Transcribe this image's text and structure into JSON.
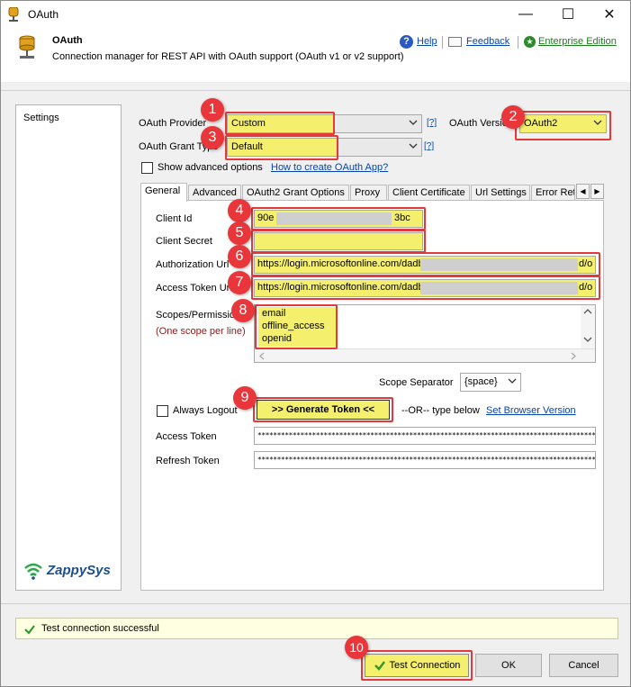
{
  "window": {
    "title": "OAuth",
    "minimize": "—",
    "maximize": "☐",
    "close": "✕"
  },
  "header": {
    "title": "OAuth",
    "subtitle": "Connection manager for REST API with OAuth support (OAuth v1 or v2 support)",
    "help": "Help",
    "feedback": "Feedback",
    "enterprise": "Enterprise Edition"
  },
  "sidebar": {
    "items": [
      {
        "label": "Settings"
      }
    ],
    "logo": "ZappySys"
  },
  "form": {
    "provider_label": "OAuth Provider",
    "provider_value": "Custom",
    "provider_help": "[?]",
    "version_label": "OAuth Version",
    "version_value": "OAuth2",
    "grant_label": "OAuth Grant Type",
    "grant_value": "Default",
    "grant_help": "[?]",
    "advanced_label": "Show advanced options",
    "howto_link": "How to create OAuth App?"
  },
  "tabs": [
    {
      "label": "General"
    },
    {
      "label": "Advanced"
    },
    {
      "label": "OAuth2 Grant Options"
    },
    {
      "label": "Proxy"
    },
    {
      "label": "Client Certificate"
    },
    {
      "label": "Url Settings"
    },
    {
      "label": "Error Ret"
    }
  ],
  "general": {
    "client_id_label": "Client Id",
    "client_id_prefix": "90e",
    "client_id_suffix": "3bc",
    "client_secret_label": "Client Secret",
    "auth_url_label": "Authorization Url",
    "auth_url_prefix": "https://login.microsoftonline.com/dadb",
    "auth_url_suffix": "d/o",
    "token_url_label": "Access Token Url",
    "token_url_prefix": "https://login.microsoftonline.com/dadb",
    "token_url_suffix": "d/o",
    "scopes_label": "Scopes/Permissions",
    "scopes_hint": "(One scope per line)",
    "scopes": [
      "email",
      "offline_access",
      "openid"
    ],
    "separator_label": "Scope Separator",
    "separator_value": "{space}",
    "always_logout_label": "Always Logout",
    "generate_button": ">> Generate Token <<",
    "or_text": "--OR-- type below",
    "browser_link": "Set Browser Version",
    "access_token_label": "Access Token",
    "access_token_value": "************************************************************************************************************************************",
    "refresh_token_label": "Refresh Token",
    "refresh_token_value": "************************************************************************************************************************************"
  },
  "status": {
    "text": "Test connection successful"
  },
  "footer": {
    "test_button": "Test Connection",
    "ok_button": "OK",
    "cancel_button": "Cancel"
  },
  "badges": [
    "1",
    "2",
    "3",
    "4",
    "5",
    "6",
    "7",
    "8",
    "9",
    "10"
  ],
  "colors": {
    "highlight": "#f4ef6d",
    "callout_red": "#e23a3a",
    "link": "#0645ad"
  }
}
